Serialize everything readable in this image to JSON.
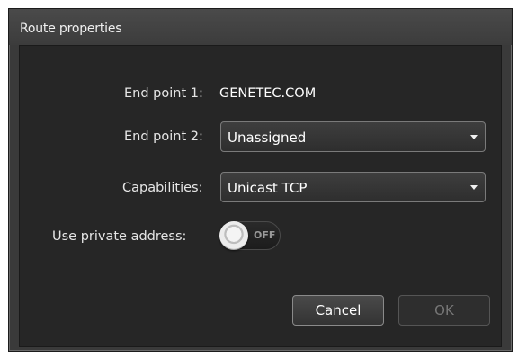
{
  "dialog": {
    "title": "Route properties"
  },
  "fields": {
    "end_point_1_label": "End point 1:",
    "end_point_1_value": "GENETEC.COM",
    "end_point_2_label": "End point 2:",
    "end_point_2_value": "Unassigned",
    "capabilities_label": "Capabilities:",
    "capabilities_value": "Unicast TCP",
    "private_address_label": "Use private address:",
    "private_address_state": "OFF"
  },
  "buttons": {
    "cancel_label": "Cancel",
    "ok_label": "OK"
  }
}
